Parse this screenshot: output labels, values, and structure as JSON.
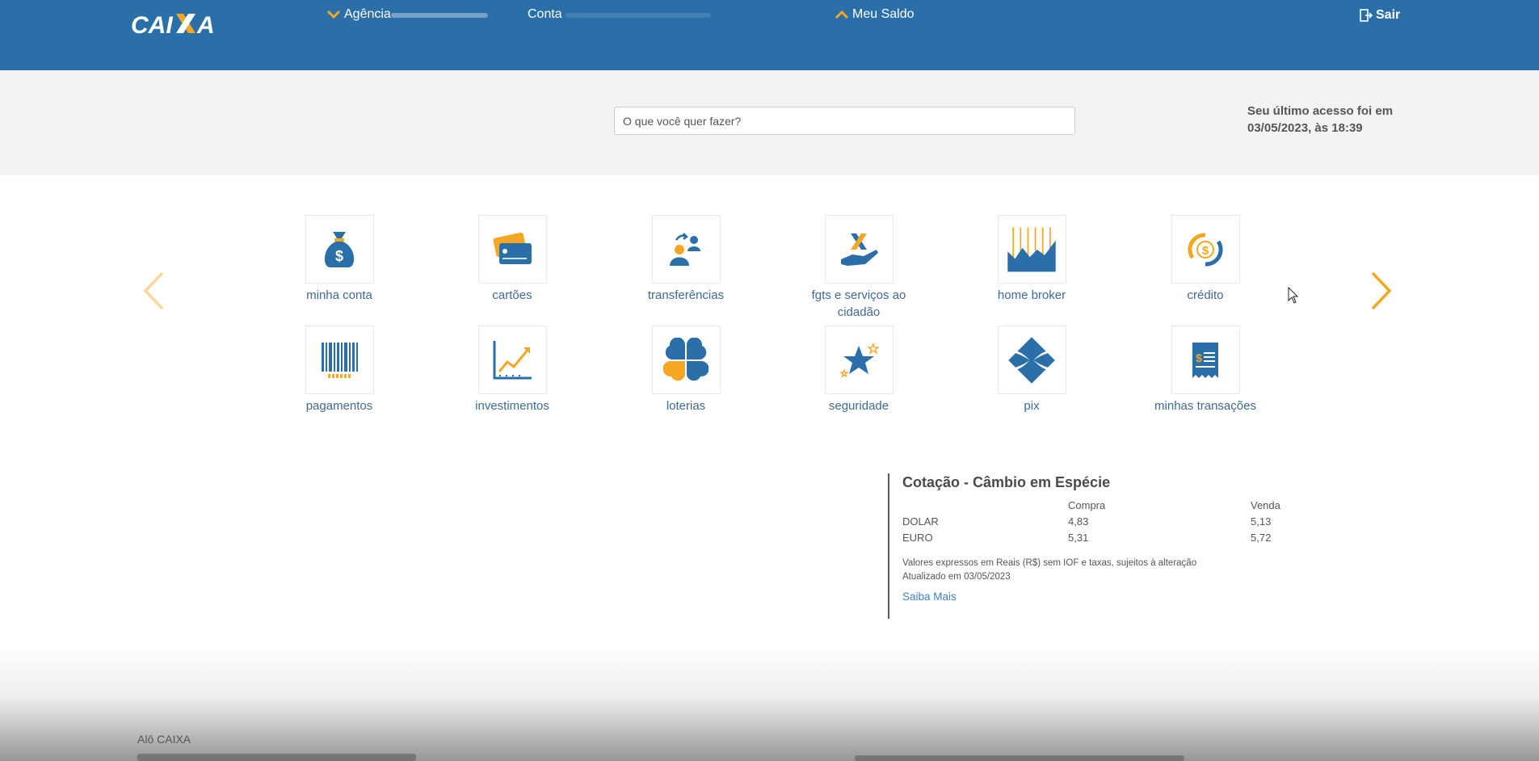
{
  "header": {
    "logo": "CAIXA",
    "agencia_label": "Agência",
    "conta_label": "Conta",
    "saldo_label": "Meu Saldo",
    "sair_label": "Sair",
    "background": "#2b6fa9",
    "accent": "#f5a623"
  },
  "search": {
    "placeholder": "O que você quer fazer?"
  },
  "last_access": {
    "line1": "Seu último acesso foi em",
    "line2": "03/05/2023, às 18:39"
  },
  "menu": {
    "items": [
      {
        "label": "minha conta",
        "icon": "money-bag-icon"
      },
      {
        "label": "cartões",
        "icon": "credit-card-icon"
      },
      {
        "label": "transferências",
        "icon": "transfer-icon"
      },
      {
        "label": "fgts e serviços ao cidadão",
        "icon": "fgts-hand-icon"
      },
      {
        "label": "home broker",
        "icon": "home-broker-chart-icon"
      },
      {
        "label": "crédito",
        "icon": "credit-cycle-icon"
      },
      {
        "label": "pagamentos",
        "icon": "barcode-icon"
      },
      {
        "label": "investimentos",
        "icon": "investment-chart-icon"
      },
      {
        "label": "loterias",
        "icon": "clover-icon"
      },
      {
        "label": "seguridade",
        "icon": "star-icon"
      },
      {
        "label": "pix",
        "icon": "pix-icon"
      },
      {
        "label": "minhas transações",
        "icon": "receipt-icon"
      }
    ]
  },
  "exchange": {
    "title": "Cotação - Câmbio em Espécie",
    "col_buy": "Compra",
    "col_sell": "Venda",
    "rows": [
      {
        "currency": "DOLAR",
        "buy": "4,83",
        "sell": "5,13"
      },
      {
        "currency": "EURO",
        "buy": "5,31",
        "sell": "5,72"
      }
    ],
    "note1": "Valores expressos em Reais (R$) sem IOF e taxas, sujeitos à alteração",
    "note2": "Atualizado em 03/05/2023",
    "more_label": "Saiba Mais"
  },
  "footer": {
    "title": "Alô CAIXA"
  }
}
